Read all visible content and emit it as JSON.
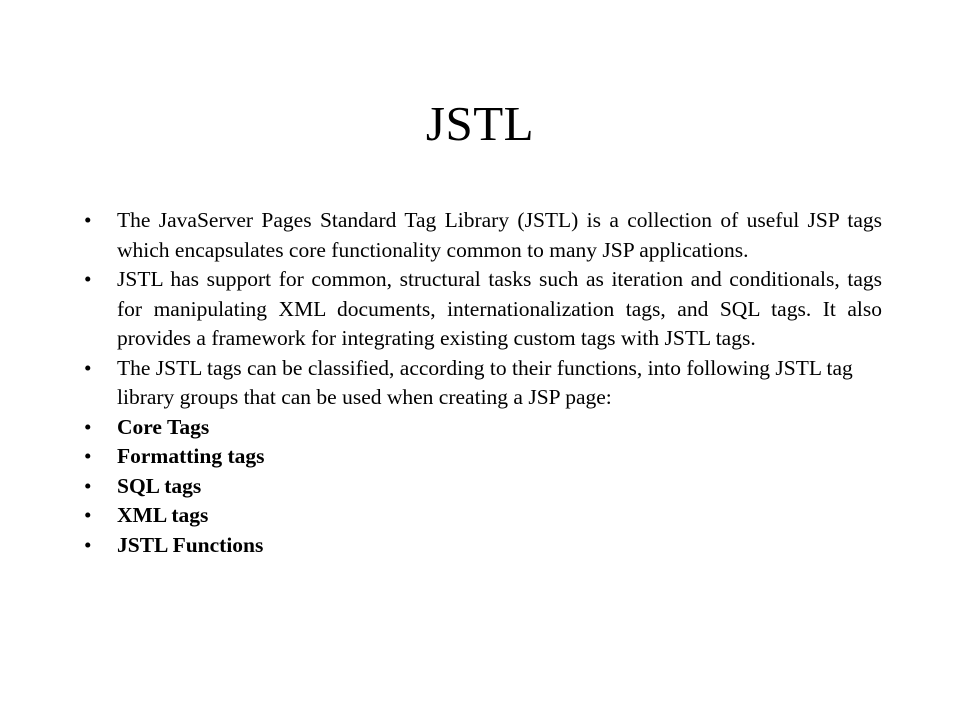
{
  "slide": {
    "title": "JSTL",
    "bullet_marker": "•",
    "text_color": "#000000",
    "background_color": "#ffffff",
    "bullets": [
      {
        "id": "intro",
        "style": "justified",
        "bold": false,
        "text": "The JavaServer Pages Standard Tag Library (JSTL) is a collection of useful JSP tags which encapsulates core functionality common to many JSP applications."
      },
      {
        "id": "support",
        "style": "justified",
        "bold": false,
        "text": "JSTL has support for common, structural tasks such as iteration and conditionals, tags for manipulating XML documents, internationalization tags, and SQL tags. It also provides a framework for integrating existing custom tags with JSTL tags."
      },
      {
        "id": "classification",
        "style": "plain",
        "bold": false,
        "text": "The JSTL tags can be classified, according to their functions, into following JSTL tag library groups that can be used when creating a JSP page:"
      },
      {
        "id": "core-tags",
        "style": "plain",
        "bold": true,
        "text": "Core Tags"
      },
      {
        "id": "formatting-tags",
        "style": "plain",
        "bold": true,
        "text": "Formatting tags"
      },
      {
        "id": "sql-tags",
        "style": "plain",
        "bold": true,
        "text": "SQL tags"
      },
      {
        "id": "xml-tags",
        "style": "plain",
        "bold": true,
        "text": "XML tags"
      },
      {
        "id": "jstl-functions",
        "style": "plain",
        "bold": true,
        "text": "JSTL Functions"
      }
    ]
  }
}
